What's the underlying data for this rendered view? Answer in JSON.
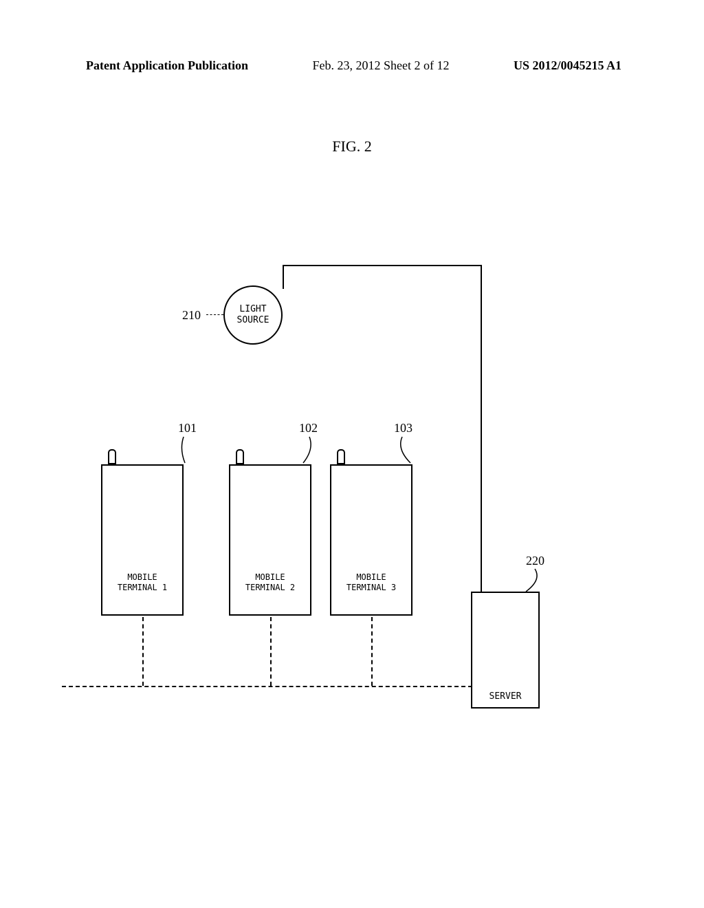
{
  "header": {
    "left": "Patent Application Publication",
    "center": "Feb. 23, 2012  Sheet 2 of 12",
    "right": "US 2012/0045215 A1"
  },
  "figure_label": "FIG. 2",
  "light_source": {
    "line1": "LIGHT",
    "line2": "SOURCE",
    "ref": "210"
  },
  "terminals": {
    "t1": {
      "line1": "MOBILE",
      "line2": "TERMINAL 1",
      "ref": "101"
    },
    "t2": {
      "line1": "MOBILE",
      "line2": "TERMINAL 2",
      "ref": "102"
    },
    "t3": {
      "line1": "MOBILE",
      "line2": "TERMINAL 3",
      "ref": "103"
    }
  },
  "server": {
    "label": "SERVER",
    "ref": "220"
  }
}
